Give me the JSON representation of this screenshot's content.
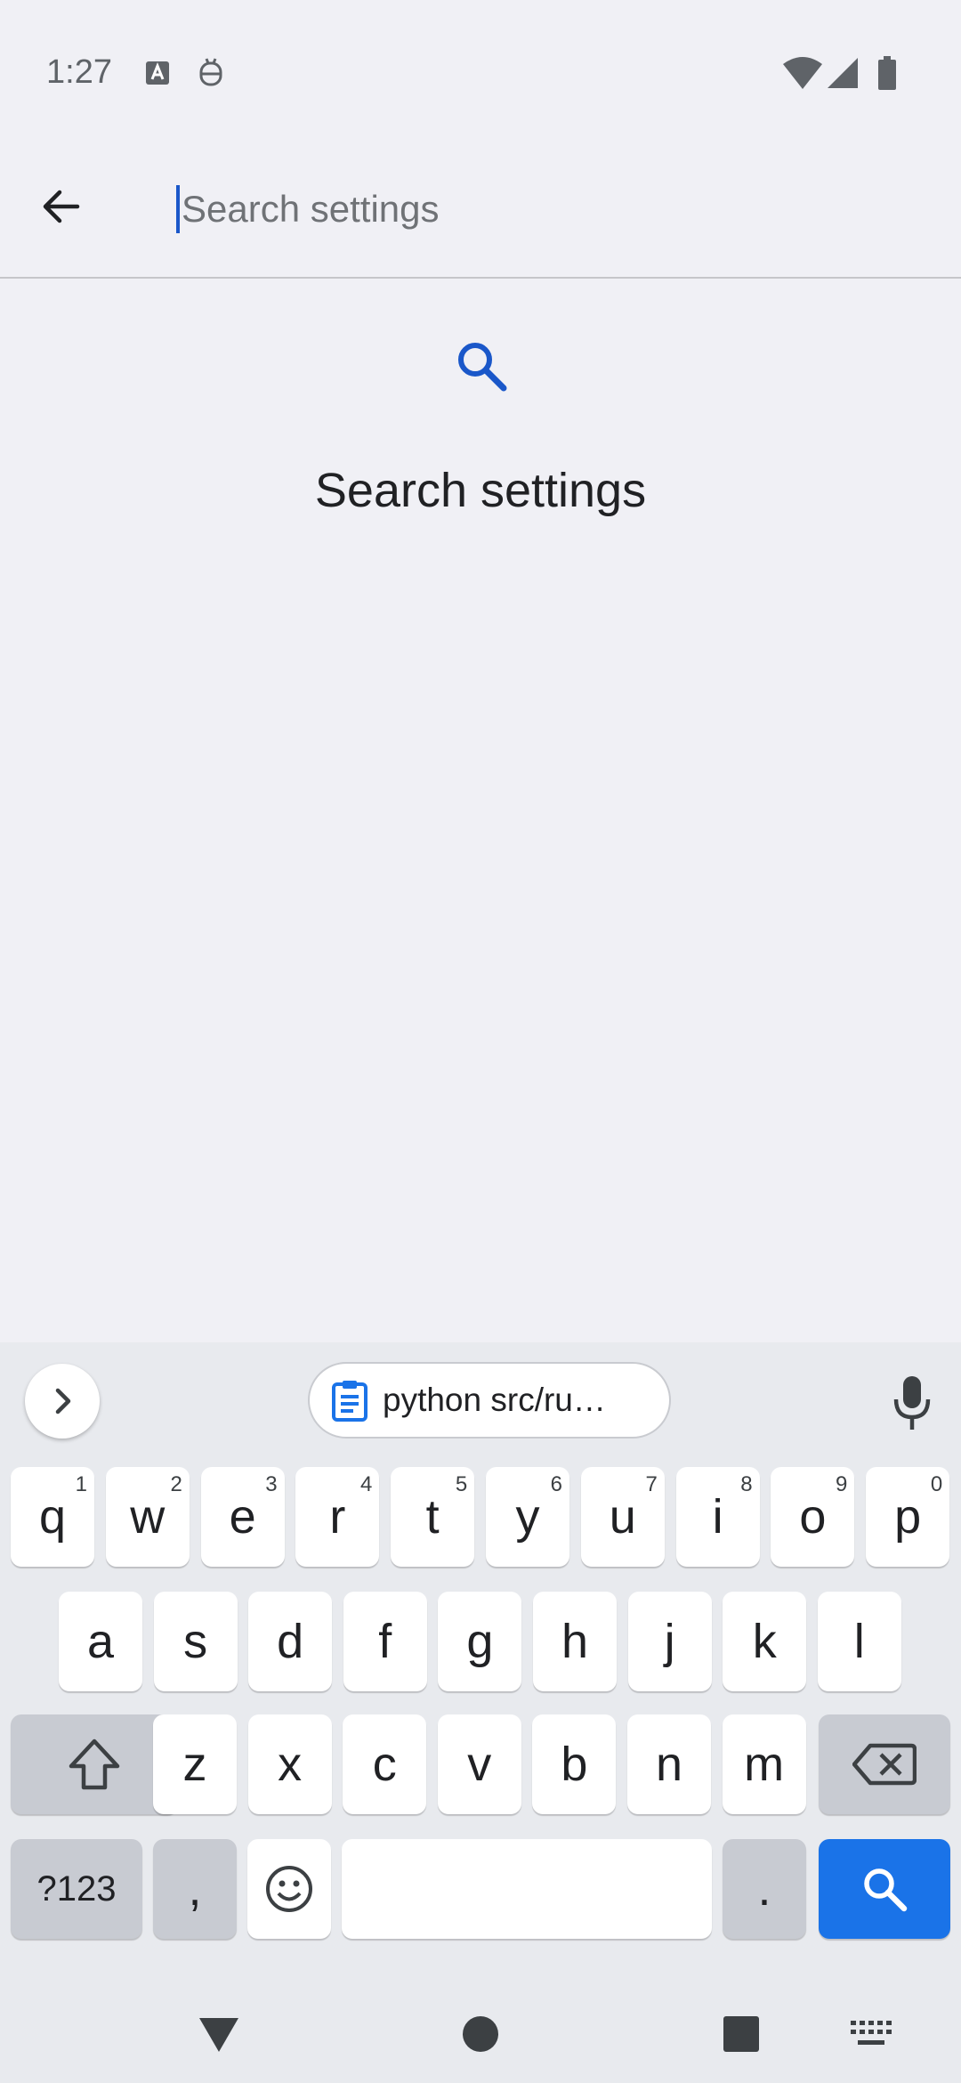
{
  "status_bar": {
    "time": "1:27"
  },
  "search": {
    "placeholder": "Search settings"
  },
  "empty_state": {
    "title": "Search settings"
  },
  "keyboard": {
    "clipboard_text": "python src/ru…",
    "row1": [
      {
        "label": "q",
        "hint": "1"
      },
      {
        "label": "w",
        "hint": "2"
      },
      {
        "label": "e",
        "hint": "3"
      },
      {
        "label": "r",
        "hint": "4"
      },
      {
        "label": "t",
        "hint": "5"
      },
      {
        "label": "y",
        "hint": "6"
      },
      {
        "label": "u",
        "hint": "7"
      },
      {
        "label": "i",
        "hint": "8"
      },
      {
        "label": "o",
        "hint": "9"
      },
      {
        "label": "p",
        "hint": "0"
      }
    ],
    "row2": [
      "a",
      "s",
      "d",
      "f",
      "g",
      "h",
      "j",
      "k",
      "l"
    ],
    "row3": [
      "z",
      "x",
      "c",
      "v",
      "b",
      "n",
      "m"
    ],
    "symbols_label": "?123",
    "comma_label": ",",
    "period_label": "."
  },
  "colors": {
    "accent": "#1a73e8",
    "cursor": "#1a57c9",
    "background": "#f0f0f5",
    "keyboard_bg": "#e8eaee"
  }
}
